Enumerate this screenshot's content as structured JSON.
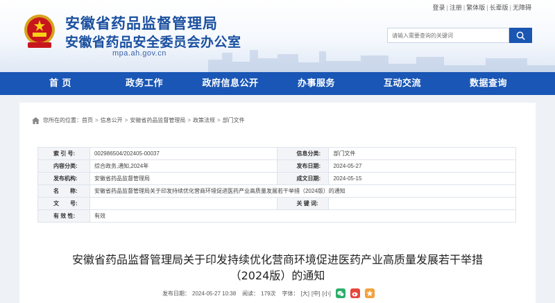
{
  "header": {
    "title": "安徽省药品监督管理局",
    "subtitle": "安徽省药品安全委员会办公室",
    "domain": "mpa.ah.gov.cn",
    "toplinks": [
      "登录",
      "注册",
      "繁体版",
      "长辈版",
      "无障碍"
    ],
    "search_placeholder": "请输入需要查询的关键词",
    "accent_color": "#1956b5"
  },
  "nav": {
    "items": [
      "首 页",
      "政务工作",
      "政府信息公开",
      "办事服务",
      "互动交流",
      "数据查询"
    ]
  },
  "breadcrumb": {
    "prefix": "您所在的位置：",
    "items": [
      "首页",
      "信息公开",
      "安徽省药品监督管理局",
      "政策法规",
      "部门文件"
    ]
  },
  "meta": {
    "rows": [
      {
        "label": "索 引 号:",
        "value": "002986504/202405-00037",
        "label2": "信息分类:",
        "value2": "部门文件"
      },
      {
        "label": "内容分类:",
        "value": "综合政务,通知,2024年",
        "label2": "发布日期:",
        "value2": "2024-05-27"
      },
      {
        "label": "发布机构:",
        "value": "安徽省药品监督管理局",
        "label2": "成文日期:",
        "value2": "2024-05-15"
      }
    ],
    "name_label": "名　　称:",
    "name_value": "安徽省药品监督管理局关于印发持续优化营商环境促进医药产业高质量发展若干举措（2024版）的通知",
    "wenhao_label": "文　　号:",
    "wenhao_value": "",
    "keyword_label": "关 键 词:",
    "keyword_value": "",
    "validity_label": "有 效 性:",
    "validity_value": "有效"
  },
  "document": {
    "title_line1": "安徽省药品监督管理局关于印发持续优化营商环境促进医药产业高质量发展若干举措",
    "title_line2": "（2024版）的通知"
  },
  "infobar": {
    "publish_label": "发布日期：",
    "publish_value": "2024-05-27 10:38",
    "views_label": "阅读：",
    "views_value": "179次",
    "font_label": "字体：",
    "font_sizes": [
      "[大]",
      "[中]",
      "[小]"
    ]
  }
}
